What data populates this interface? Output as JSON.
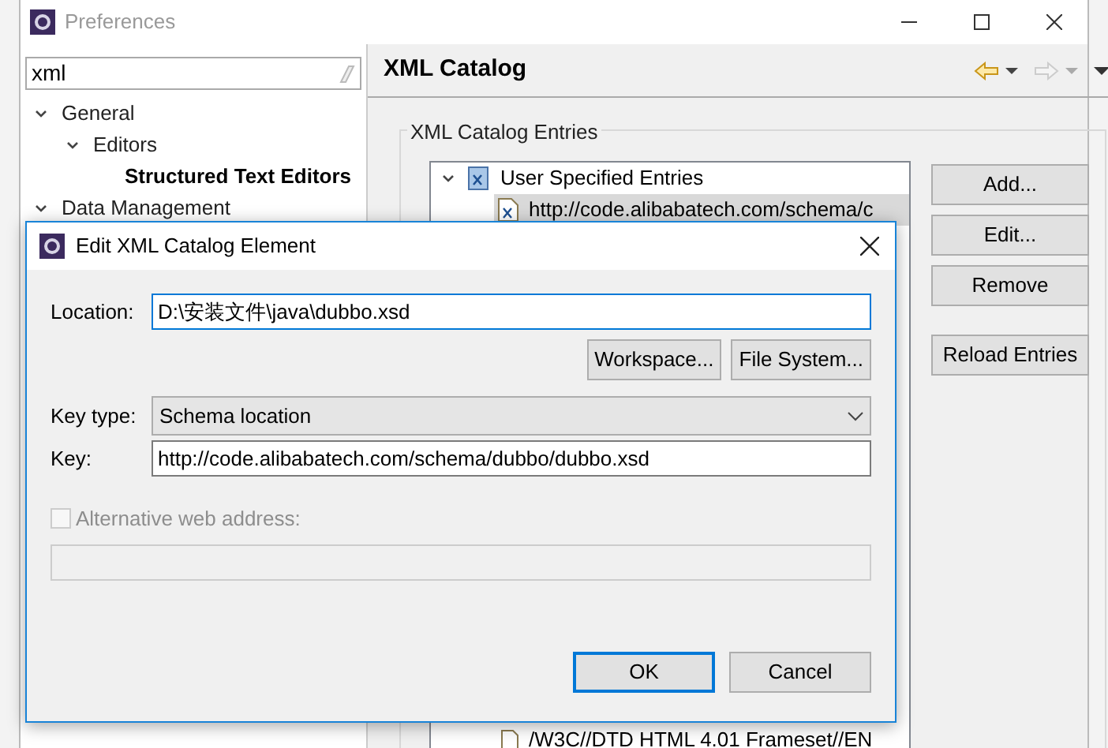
{
  "window": {
    "title": "Preferences"
  },
  "filter": {
    "value": "xml"
  },
  "tree": [
    {
      "label": "General",
      "expanded": true,
      "bold": false,
      "children": [
        {
          "label": "Editors",
          "expanded": true,
          "bold": false,
          "children": [
            {
              "label": "Structured Text Editors",
              "bold": true
            }
          ]
        }
      ]
    },
    {
      "label": "Data Management",
      "expanded": true,
      "bold": false
    }
  ],
  "page": {
    "title": "XML Catalog",
    "group": "XML Catalog Entries",
    "entries": [
      {
        "label": "User Specified Entries",
        "kind": "folder",
        "expanded": true,
        "selected": false,
        "children": [
          {
            "label": "http://code.alibabatech.com/schema/c",
            "kind": "file",
            "selected": true
          }
        ]
      }
    ],
    "hidden_entries": [
      {
        "label": "/W3C//DTD HTML 4.01 Frameset//EN"
      }
    ],
    "buttons": [
      "Add...",
      "Edit...",
      "Remove",
      "Reload Entries"
    ]
  },
  "dialog": {
    "title": "Edit XML Catalog Element",
    "location": {
      "label": "Location:",
      "value": "D:\\安装文件\\java\\dubbo.xsd"
    },
    "location_buttons": [
      "Workspace...",
      "File System..."
    ],
    "key_type": {
      "label": "Key type:",
      "value": "Schema location"
    },
    "key": {
      "label": "Key:",
      "value": "http://code.alibabatech.com/schema/dubbo/dubbo.xsd"
    },
    "alternative": {
      "label": "Alternative web address:",
      "checked": false,
      "disabled": true
    },
    "buttons": [
      {
        "label": "OK",
        "default": true
      },
      {
        "label": "Cancel",
        "default": false
      }
    ]
  }
}
